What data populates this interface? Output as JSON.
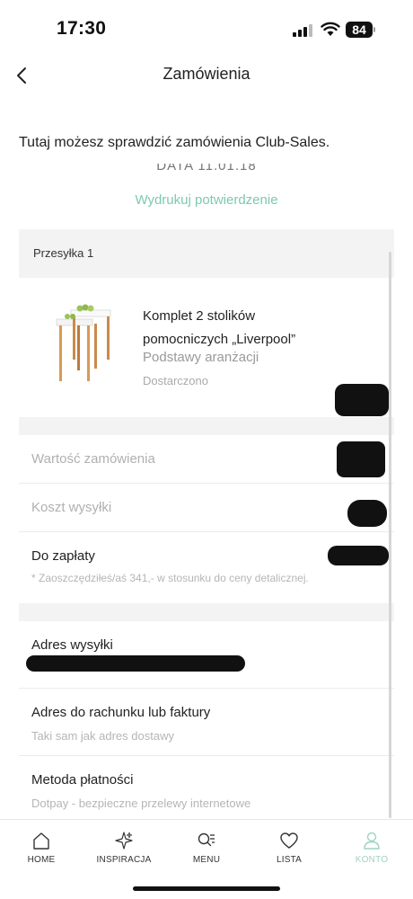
{
  "status": {
    "time": "17:30",
    "battery": "84"
  },
  "nav": {
    "title": "Zamówienia"
  },
  "intro": "Tutaj możesz sprawdzić zamówienia Club-Sales.",
  "date_partial": "DATA 11.01.18",
  "print_link": "Wydrukuj potwierdzenie",
  "shipment": {
    "title": "Przesyłka 1",
    "product": {
      "name": "Komplet 2 stolików pomocniczych „Liverpool”",
      "category": "Podstawy aranżacji",
      "status": "Dostarczono"
    }
  },
  "summary": {
    "order_value_label": "Wartość zamówienia",
    "shipping_label": "Koszt wysyłki",
    "to_pay_label": "Do zapłaty",
    "savings_note": "* Zaoszczędziłeś/aś 341,- w stosunku do ceny detalicznej."
  },
  "shipping_address": {
    "label": "Adres wysyłki"
  },
  "billing_address": {
    "label": "Adres do rachunku lub faktury",
    "value": "Taki sam jak adres dostawy"
  },
  "payment": {
    "label": "Metoda płatności",
    "value": "Dotpay - bezpieczne przelewy internetowe"
  },
  "tabs": [
    {
      "label": "HOME",
      "icon": "home-icon"
    },
    {
      "label": "INSPIRACJA",
      "icon": "sparkle-icon"
    },
    {
      "label": "MENU",
      "icon": "menu-search-icon"
    },
    {
      "label": "LISTA",
      "icon": "heart-icon"
    },
    {
      "label": "KONTO",
      "icon": "person-icon",
      "active": true
    }
  ],
  "colors": {
    "accent": "#7ec9ac",
    "active_tab": "#9fd3c4",
    "section_bg": "#f3f3f3"
  }
}
